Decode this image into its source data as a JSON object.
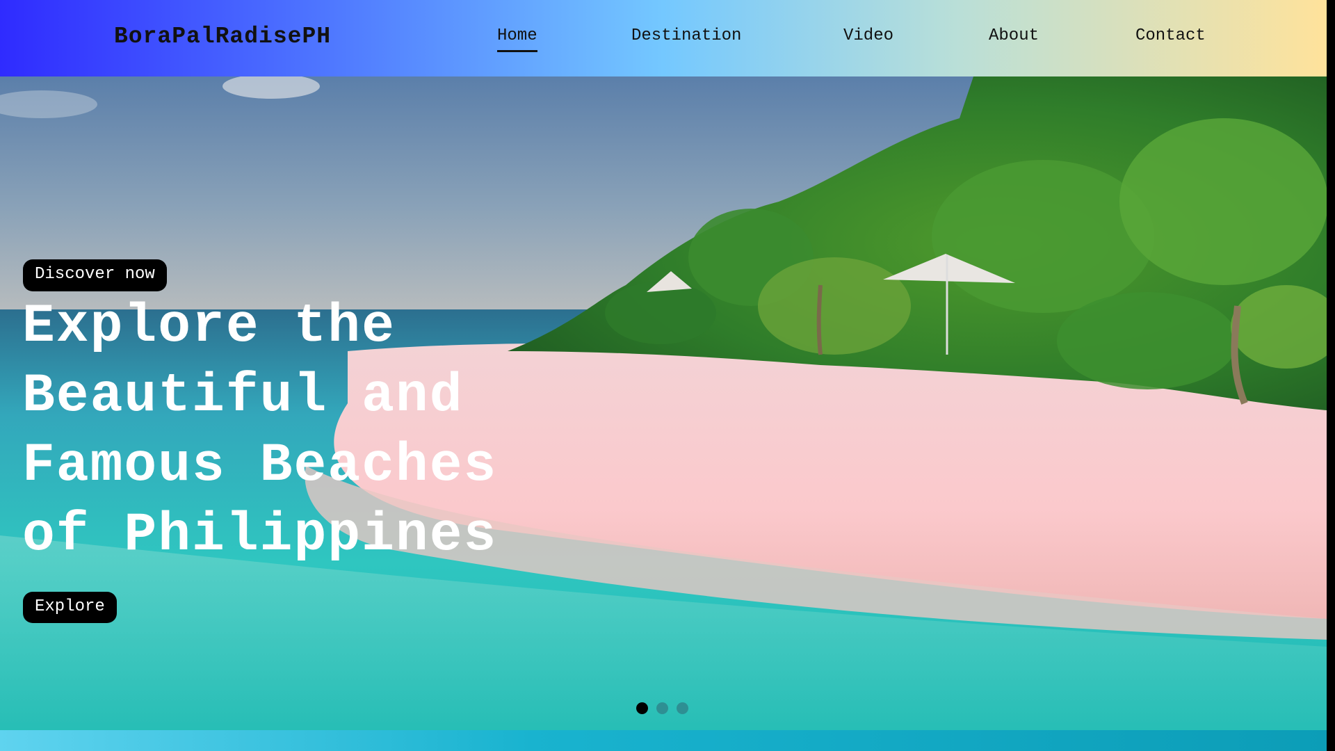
{
  "brand": {
    "name": "BoraPalRadisePH"
  },
  "nav": {
    "items": [
      {
        "label": "Home",
        "active": true
      },
      {
        "label": "Destination",
        "active": false
      },
      {
        "label": "Video",
        "active": false
      },
      {
        "label": "About",
        "active": false
      },
      {
        "label": "Contact",
        "active": false
      }
    ]
  },
  "hero": {
    "tag_button": "Discover now",
    "headline_lines": [
      "Explore the",
      "Beautiful and",
      "Famous Beaches",
      "of Philippines"
    ],
    "cta_button": "Explore",
    "slides": {
      "count": 3,
      "active_index": 0
    }
  },
  "colors": {
    "navbar_gradient": [
      "#2f2bff",
      "#74c8ff",
      "#ffe29b"
    ],
    "button_bg": "#000000",
    "button_text": "#ffffff",
    "headline_text": "#ffffff",
    "dot_active": "#000000",
    "dot_inactive": "#2e8f93"
  }
}
